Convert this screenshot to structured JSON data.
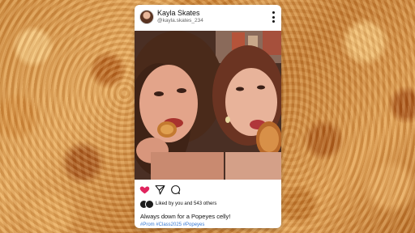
{
  "post": {
    "username": "Kayla Skates",
    "handle": "@kayla.skates_234",
    "liked_by": "Liked by you and 543 others",
    "caption": "Always down for a Popeyes celly!",
    "hashtags": "#Prom #Class2025 #Popeyes"
  },
  "icons": {
    "menu": "more-vertical-icon",
    "like": "heart-icon",
    "share": "send-icon",
    "comment": "comment-icon"
  },
  "colors": {
    "like_red": "#e0245e",
    "hashtag_blue": "#3a7bd5",
    "background_fried_chicken": "#d08a3c"
  }
}
